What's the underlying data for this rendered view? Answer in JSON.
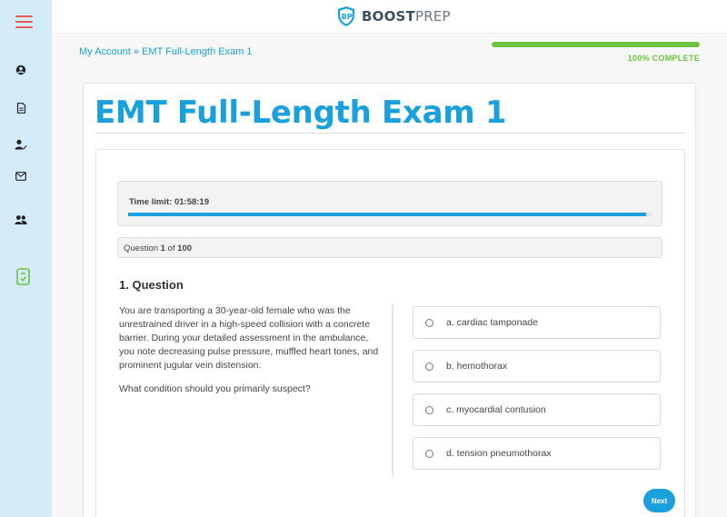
{
  "brand": {
    "name_bold": "BOOST",
    "name_light": "PREP"
  },
  "sidebar": {
    "icons": [
      "account-icon",
      "document-icon",
      "user-edit-icon",
      "mail-icon",
      "users-icon",
      "exam-icon"
    ]
  },
  "breadcrumb": {
    "home": "My Account",
    "separator": " » ",
    "current": "EMT Full-Length Exam 1"
  },
  "progress": {
    "percent": 100,
    "label": "100% COMPLETE"
  },
  "page": {
    "title": "EMT Full-Length Exam 1"
  },
  "quiz": {
    "time_limit_label": "Time limit: 01:58:19",
    "time_remaining_fraction": 0.99,
    "question_prefix": "Question ",
    "question_current": "1",
    "question_of": " of ",
    "question_total": "100",
    "question_heading": "1. Question",
    "question_text": "You are transporting a 30-year-old female who was the unrestrained driver in a high-speed collision with a concrete barrier. During your detailed assessment in the ambulance, you note decreasing pulse pressure, muffled heart tones, and prominent jugular vein distension.",
    "question_prompt": "What condition should you primarily suspect?",
    "answers": [
      "a. cardiac tamponade",
      "b. hemothorax",
      "c. myocardial contusion",
      "d. tension pneumothorax"
    ],
    "next_label": "Next"
  },
  "colors": {
    "accent": "#1aa0dc",
    "success": "#6ec23f",
    "menu": "#e95a4f",
    "sidebar_bg": "#d4ecf9"
  }
}
